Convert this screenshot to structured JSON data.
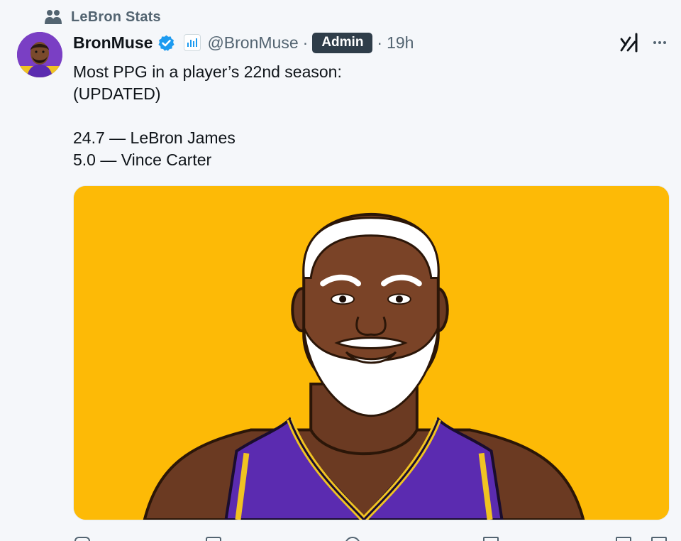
{
  "community": {
    "label": "LeBron Stats",
    "icon": "community-icon"
  },
  "author": {
    "display_name": "BronMuse",
    "handle": "@BronMuse",
    "role_badge": "Admin",
    "time": "19h",
    "separator": "·",
    "verified_color": "#1d9bf0"
  },
  "tweet": {
    "lines": [
      "Most PPG in a player’s 22nd season:",
      "(UPDATED)",
      "",
      "24.7 — LeBron James",
      "5.0 — Vince Carter"
    ]
  },
  "media": {
    "background_color": "#fdba06",
    "jersey_color": "#5b2bb0"
  },
  "icons": [
    "community-icon",
    "verified-icon",
    "affiliate-badge-icon",
    "grok-icon",
    "more-icon",
    "reply-icon",
    "repost-icon",
    "like-icon",
    "views-icon",
    "bookmark-icon",
    "share-icon"
  ]
}
